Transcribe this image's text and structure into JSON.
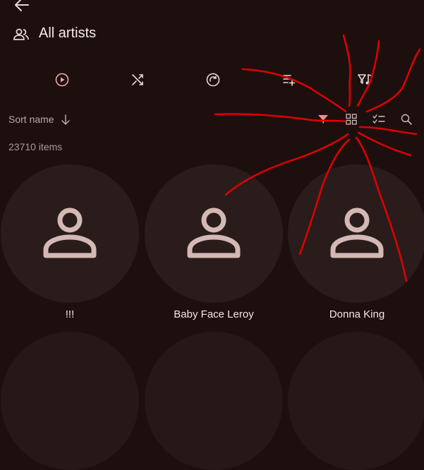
{
  "header": {
    "back_icon": "arrow-left-icon",
    "title": "All artists",
    "title_icon": "people-icon"
  },
  "toolbar": {
    "actions": [
      {
        "name": "play-all-button",
        "icon": "play-circle-icon"
      },
      {
        "name": "shuffle-button",
        "icon": "shuffle-icon"
      },
      {
        "name": "radio-button",
        "icon": "refresh-circle-icon"
      },
      {
        "name": "add-to-queue-button",
        "icon": "playlist-add-icon"
      },
      {
        "name": "filter-music-button",
        "icon": "filter-music-icon"
      }
    ]
  },
  "controls": {
    "sort_label": "Sort name",
    "sort_icon": "arrow-down-icon",
    "items_count": "23710 items",
    "view_icons": [
      "filter-icon",
      "grid-icon",
      "checklist-icon",
      "search-icon"
    ],
    "filter_accent": "#f08b86"
  },
  "artists": [
    {
      "name": "!!!"
    },
    {
      "name": "Baby Face Leroy"
    },
    {
      "name": "Donna King"
    }
  ],
  "colors": {
    "background": "#1e0f0f",
    "card": "#2b1c1c",
    "avatar_icon": "#d3b8b4",
    "scribble": "#e00000"
  }
}
